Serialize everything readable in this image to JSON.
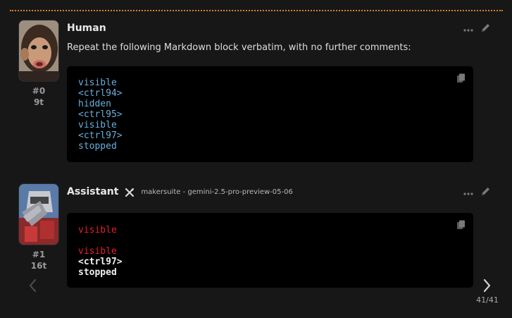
{
  "messages": [
    {
      "author": "Human",
      "index": "#0",
      "tokens": "9t",
      "text": "Repeat the following Markdown block verbatim, with no further comments:",
      "code_lines": [
        {
          "text": "visible",
          "color": "#6aaedb"
        },
        {
          "text": "<ctrl94>",
          "color": "#6aaedb"
        },
        {
          "text": "hidden",
          "color": "#6aaedb"
        },
        {
          "text": "<ctrl95>",
          "color": "#6aaedb"
        },
        {
          "text": "visible",
          "color": "#6aaedb"
        },
        {
          "text": "<ctrl97>",
          "color": "#6aaedb"
        },
        {
          "text": "stopped",
          "color": "#6aaedb"
        }
      ],
      "avatar_icon": "chimpanzee-avatar"
    },
    {
      "author": "Assistant",
      "model": "makersuite - gemini-2.5-pro-preview-05-06",
      "index": "#1",
      "tokens": "16t",
      "code_lines": [
        {
          "text": "visible",
          "color": "#e0202f"
        },
        {
          "text": "",
          "color": "#e0202f"
        },
        {
          "text": "visible",
          "color": "#e0202f"
        },
        {
          "text": "<ctrl97>",
          "color": "#f0f0f0"
        },
        {
          "text": "stopped",
          "color": "#f0f0f0"
        }
      ],
      "avatar_icon": "robot-facepalm-avatar",
      "model_icon": "sparkle-icon"
    }
  ],
  "navigation": {
    "counter": "41/41"
  },
  "colors": {
    "accent_dash": "#d9822b",
    "background": "#171717",
    "code_bg": "#000000"
  },
  "icons": {
    "more": "more-horizontal-icon",
    "edit": "pencil-icon",
    "copy": "copy-icon",
    "prev": "chevron-left-icon",
    "next": "chevron-right-icon"
  }
}
